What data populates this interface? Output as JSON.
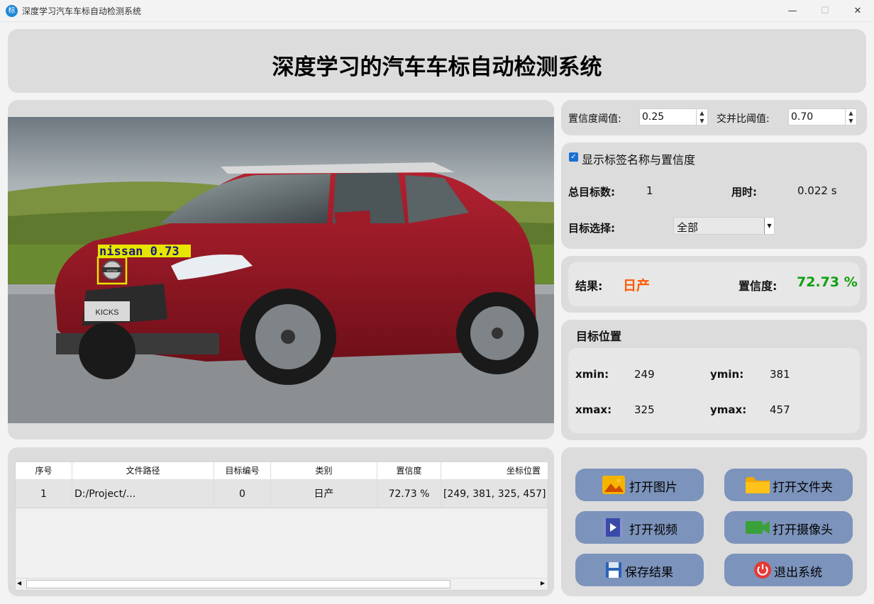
{
  "window": {
    "title": "深度学习汽车车标自动检测系统",
    "icon_text": "标"
  },
  "header": {
    "title": "深度学习的汽车车标自动检测系统"
  },
  "detection": {
    "box_label": "nissan 0.73"
  },
  "image": {
    "plate_text": "KICKS",
    "badge_text": "NISSAN"
  },
  "params": {
    "conf_label": "置信度阈值:",
    "conf_value": "0.25",
    "iou_label": "交并比阈值:",
    "iou_value": "0.70"
  },
  "info": {
    "show_label_text": "显示标签名称与置信度",
    "total_label": "总目标数:",
    "total_value": "1",
    "time_label": "用时:",
    "time_value": "0.022 s",
    "select_label": "目标选择:",
    "select_value": "全部"
  },
  "result": {
    "label": "结果:",
    "value": "日产",
    "conf_label": "置信度:",
    "conf_value": "72.73 %",
    "value_color": "#ff5a00",
    "conf_color": "#10a010"
  },
  "position": {
    "title": "目标位置",
    "xmin_label": "xmin:",
    "xmin": "249",
    "ymin_label": "ymin:",
    "ymin": "381",
    "xmax_label": "xmax:",
    "xmax": "325",
    "ymax_label": "ymax:",
    "ymax": "457"
  },
  "table": {
    "headers": [
      "序号",
      "文件路径",
      "目标编号",
      "类别",
      "置信度",
      "坐标位置"
    ],
    "rows": [
      [
        "1",
        "D:/Project/...",
        "0",
        "日产",
        "72.73 %",
        "[249, 381, 325, 457]"
      ]
    ]
  },
  "buttons": {
    "open_image": "打开图片",
    "open_folder": "打开文件夹",
    "open_video": "打开视频",
    "open_camera": "打开摄像头",
    "save": "保存结果",
    "exit": "退出系统"
  }
}
